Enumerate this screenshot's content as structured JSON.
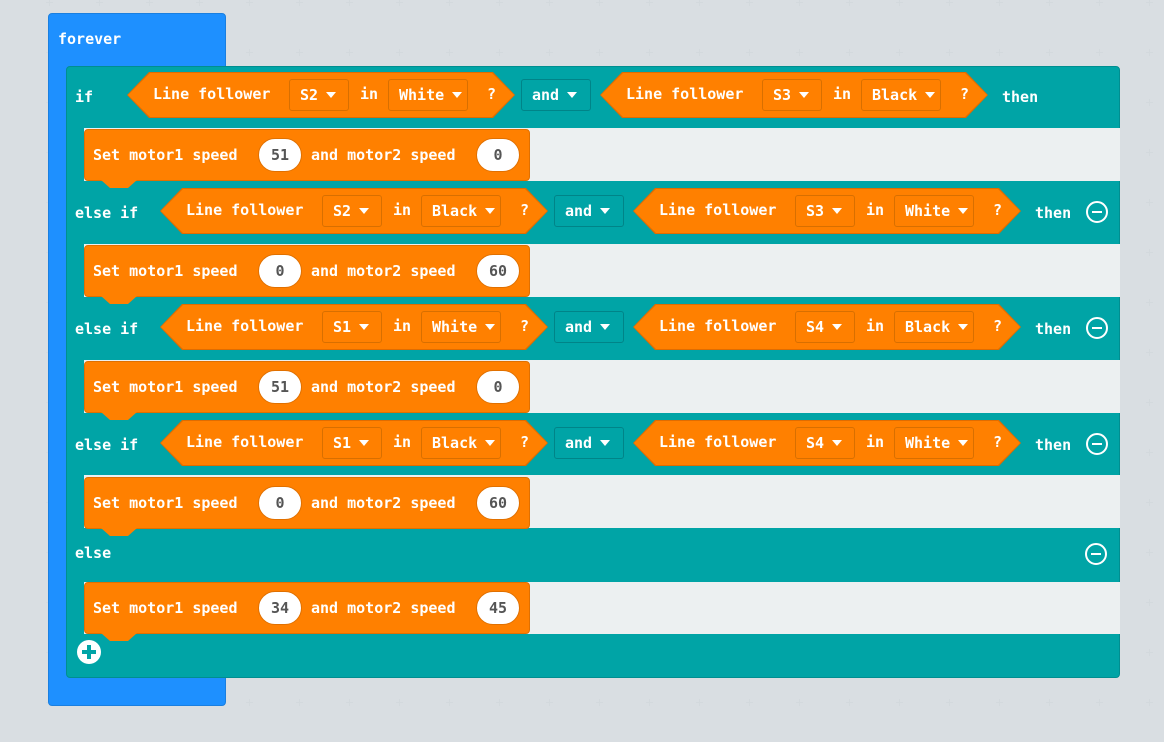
{
  "forever_label": "forever",
  "if_kw": "if",
  "elseif_kw": "else if",
  "else_kw": "else",
  "then_kw": "then",
  "and_kw": "and",
  "in_kw": "in",
  "q": "?",
  "sensor_label": "Line follower",
  "motor1": "Set motor1 speed",
  "motor2": "and motor2 speed",
  "branches": [
    {
      "a_sensor": "S2",
      "a_color": "White",
      "b_sensor": "S3",
      "b_color": "Black",
      "m1": "51",
      "m2": "0"
    },
    {
      "a_sensor": "S2",
      "a_color": "Black",
      "b_sensor": "S3",
      "b_color": "White",
      "m1": "0",
      "m2": "60"
    },
    {
      "a_sensor": "S1",
      "a_color": "White",
      "b_sensor": "S4",
      "b_color": "Black",
      "m1": "51",
      "m2": "0"
    },
    {
      "a_sensor": "S1",
      "a_color": "Black",
      "b_sensor": "S4",
      "b_color": "White",
      "m1": "0",
      "m2": "60"
    }
  ],
  "else_motor": {
    "m1": "34",
    "m2": "45"
  },
  "colors": {
    "forever": "#1e90ff",
    "logic": "#00a4a6",
    "sensor": "#ff8000",
    "canvas": "#ecf0f1"
  }
}
